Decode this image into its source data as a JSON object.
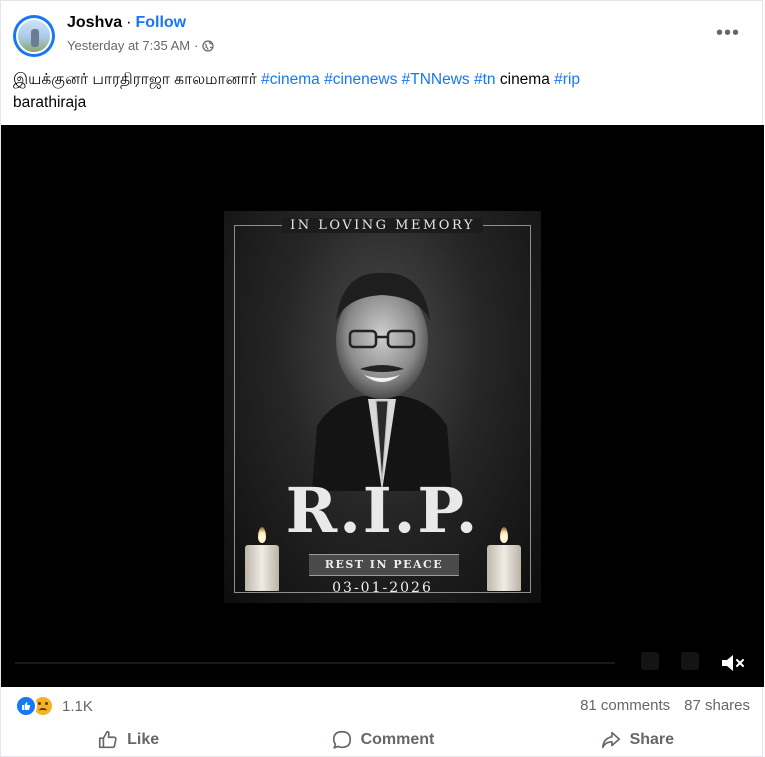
{
  "post": {
    "author": "Joshva",
    "separator": "·",
    "follow_label": "Follow",
    "timestamp": "Yesterday at 7:35 AM",
    "meta_separator": "·",
    "privacy_icon": "globe-icon",
    "more_label": "•••",
    "caption": {
      "text1": "இயக்குனர் பாரதிராஜா காலமானார் ",
      "tag1": "#cinema",
      "tag2": "#cinenews",
      "tag3": "#TNNews",
      "tag4": "#tn",
      "text2": " cinema ",
      "tag5": "#rip",
      "text3": "barathiraja"
    }
  },
  "video": {
    "poster": {
      "header": "IN LOVING MEMORY",
      "rip": "R.I.P.",
      "ribbon": "REST IN PEACE",
      "date": "03-01-2026"
    },
    "mute_icon": "speaker-muted-icon"
  },
  "stats": {
    "reactions": [
      "like",
      "sad"
    ],
    "reaction_count": "1.1K",
    "comments": "81 comments",
    "shares": "87 shares"
  },
  "actions": {
    "like": "Like",
    "comment": "Comment",
    "share": "Share"
  },
  "colors": {
    "accent": "#1877f2",
    "muted_text": "#65676b",
    "video_bg": "#000000"
  }
}
